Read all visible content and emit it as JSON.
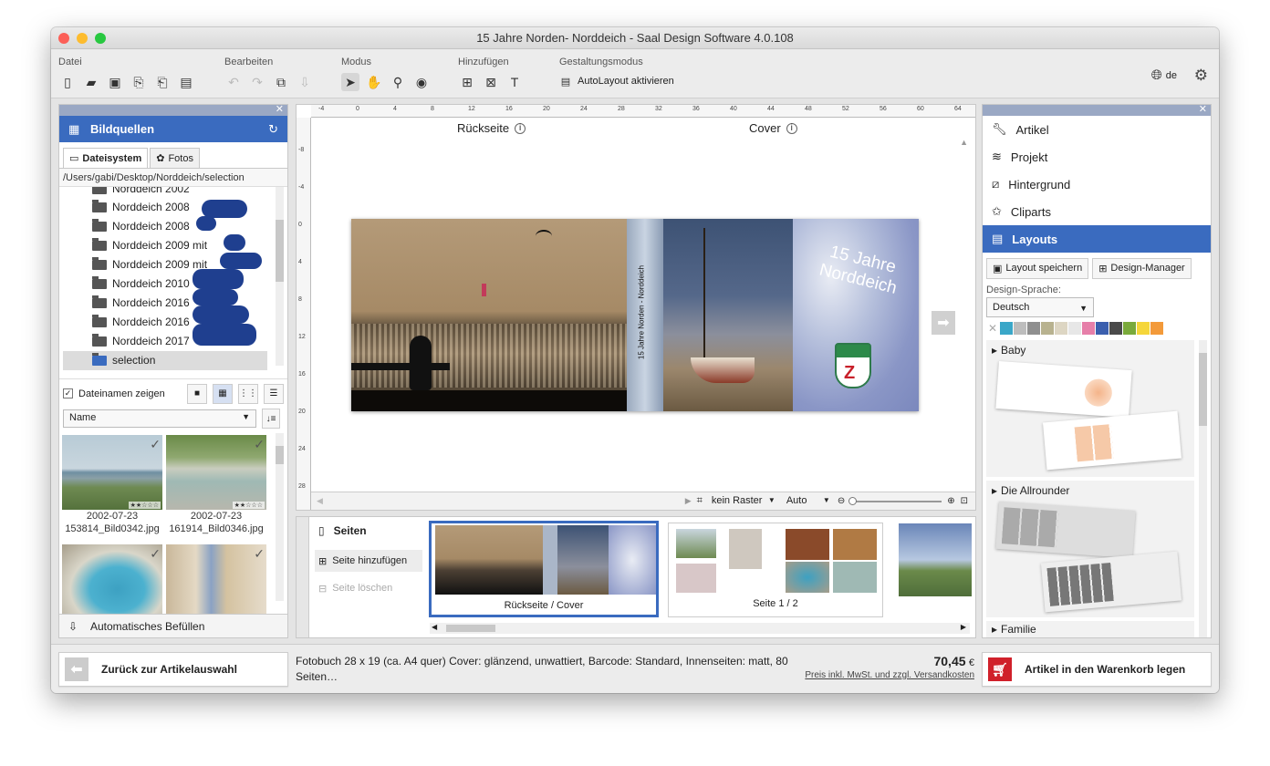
{
  "window": {
    "title": "15 Jahre Norden- Norddeich - Saal Design Software 4.0.108"
  },
  "toolbar": {
    "groups": [
      {
        "label": "Datei"
      },
      {
        "label": "Bearbeiten"
      },
      {
        "label": "Modus"
      },
      {
        "label": "Hinzufügen"
      },
      {
        "label": "Gestaltungsmodus"
      }
    ],
    "autolayout_label": "AutoLayout aktivieren",
    "language": "de"
  },
  "left": {
    "title": "Bildquellen",
    "tabs": [
      "Dateisystem",
      "Fotos"
    ],
    "path": "/Users/gabi/Desktop/Norddeich/selection",
    "tree": [
      "Norddeich 2002",
      "Norddeich 2008",
      "Norddeich 2008",
      "Norddeich 2009 mit",
      "Norddeich 2009 mit",
      "Norddeich 2010",
      "Norddeich 2016",
      "Norddeich 2016",
      "Norddeich 2017",
      "selection"
    ],
    "show_names_label": "Dateinamen zeigen",
    "sort_value": "Name",
    "thumbs": [
      {
        "date": "2002-07-23",
        "file": "153814_Bild0342.jpg"
      },
      {
        "date": "2002-07-23",
        "file": "161914_Bild0346.jpg"
      },
      {
        "date": "",
        "file": ""
      },
      {
        "date": "",
        "file": ""
      }
    ],
    "autofill_label": "Automatisches Befüllen"
  },
  "canvas": {
    "back_label": "Rückseite",
    "cover_label": "Cover",
    "ruler_h": [
      "-4",
      "0",
      "4",
      "8",
      "12",
      "16",
      "20",
      "24",
      "28",
      "32",
      "36",
      "40",
      "44",
      "48",
      "52",
      "56",
      "60",
      "64"
    ],
    "ruler_v": [
      "-8",
      "-4",
      "0",
      "4",
      "8",
      "12",
      "16",
      "20",
      "24",
      "28"
    ],
    "spine_text": "15 Jahre Norden - Norddeich",
    "cover_text_1": "15 Jahre",
    "cover_text_2": "Norddeich",
    "grid_value": "kein Raster",
    "zoom_value": "Auto"
  },
  "pages": {
    "title": "Seiten",
    "add_label": "Seite hinzufügen",
    "delete_label": "Seite löschen",
    "thumb1_label": "Rückseite / Cover",
    "thumb2_label": "Seite 1 / 2"
  },
  "right": {
    "items": [
      "Artikel",
      "Projekt",
      "Hintergrund",
      "Cliparts",
      "Layouts"
    ],
    "save_layout": "Layout speichern",
    "design_manager": "Design-Manager",
    "lang_label": "Design-Sprache:",
    "lang_value": "Deutsch",
    "swatches": [
      "#3aa7c8",
      "#bdbdbd",
      "#8f8f8f",
      "#b8b28f",
      "#ddd6c3",
      "#e7e7e7",
      "#e67fa9",
      "#3b5fae",
      "#4a4a4a",
      "#7aaa3b",
      "#f5d63a",
      "#f39a3a"
    ],
    "cat1": "Baby",
    "cat2": "Die Allrounder",
    "cat3": "Familie"
  },
  "bottom": {
    "back_button": "Zurück zur Artikelauswahl",
    "desc": "Fotobuch 28 x 19 (ca. A4 quer) Cover: glänzend, unwattiert, Barcode: Standard, Innenseiten: matt, 80 Seiten…",
    "price": "70,45",
    "currency": "€",
    "price_note": "Preis inkl. MwSt. und zzgl. Versandkosten",
    "cart_button": "Artikel in den Warenkorb legen"
  }
}
